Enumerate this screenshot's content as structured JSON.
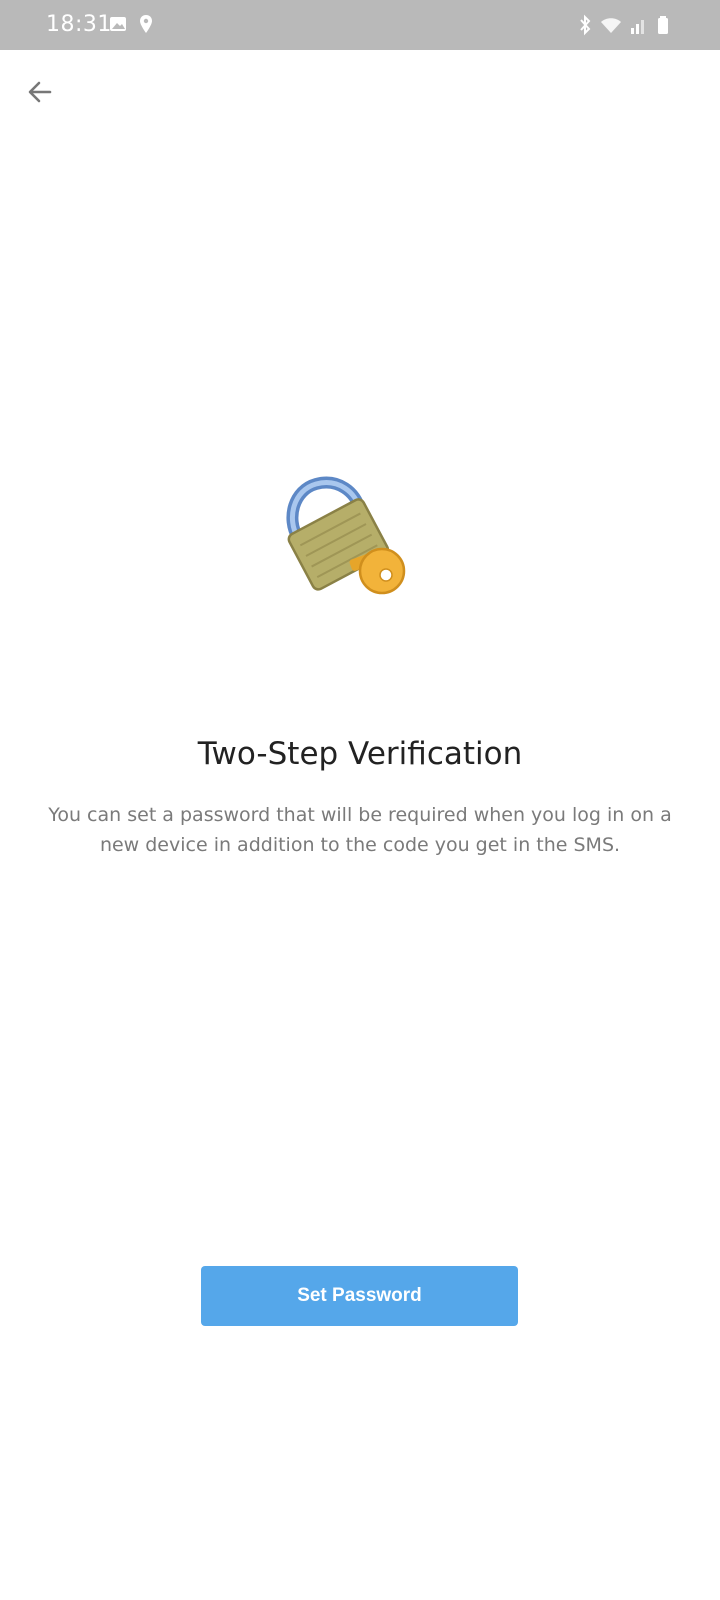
{
  "status_bar": {
    "time": "18:31",
    "left_icons": [
      "gallery-icon",
      "location-icon"
    ],
    "right_icons": [
      "bluetooth-icon",
      "wifi-icon",
      "signal-icon",
      "battery-icon"
    ],
    "background_color": "#b9b9b9"
  },
  "header": {
    "back_icon": "arrow-left-icon"
  },
  "illustration": {
    "icon": "lock-with-key-icon"
  },
  "main": {
    "title": "Two-Step Verification",
    "description": "You can set a password that will be required when you log in on a new device in addition to the code you get in the SMS."
  },
  "actions": {
    "set_password_label": "Set Password",
    "button_color": "#55a7ea"
  }
}
